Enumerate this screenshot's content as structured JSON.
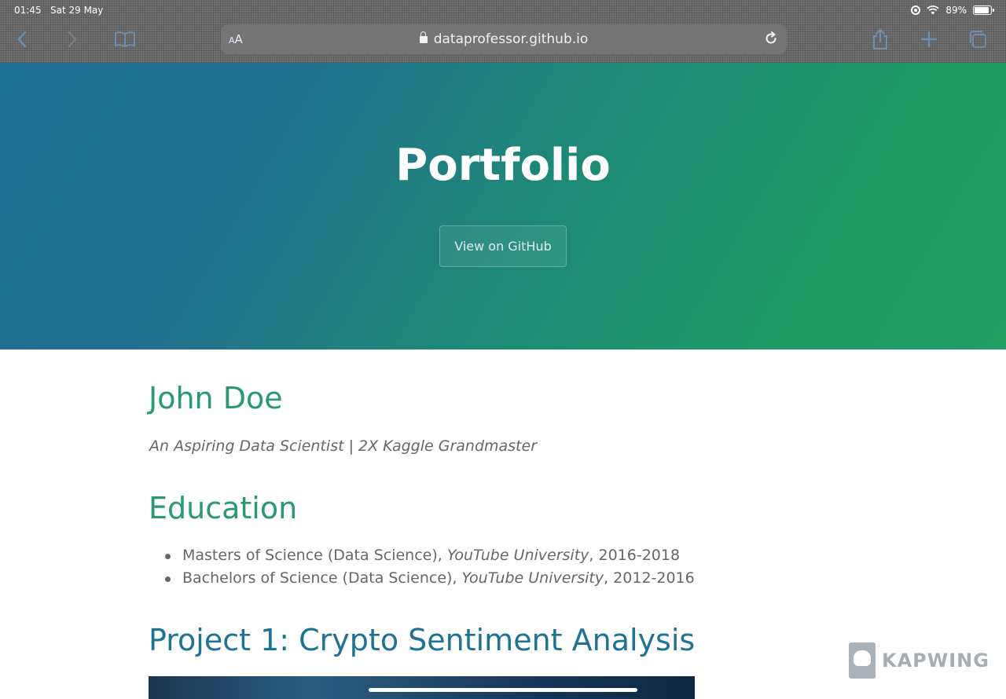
{
  "status_bar": {
    "time": "01:45",
    "date": "Sat 29 May",
    "battery": "89%",
    "battery_level": 0.89
  },
  "browser": {
    "aa_label_small": "A",
    "aa_label_large": "A",
    "url": "dataprofessor.github.io",
    "icons": [
      "back-icon",
      "forward-icon",
      "bookmarks-icon",
      "lock-icon",
      "reload-icon",
      "share-icon",
      "new-tab-icon",
      "tabs-icon"
    ]
  },
  "hero": {
    "title": "Portfolio",
    "button_label": "View on GitHub"
  },
  "profile": {
    "name": "John Doe",
    "tagline": "An Aspiring Data Scientist | 2X Kaggle Grandmaster"
  },
  "education": {
    "title": "Education",
    "items": [
      {
        "degree": "Masters of Science (Data Science), ",
        "school": "YouTube University",
        "years": ", 2016-2018"
      },
      {
        "degree": "Bachelors of Science (Data Science), ",
        "school": "YouTube University",
        "years": ", 2012-2016"
      }
    ]
  },
  "project": {
    "title": "Project 1: Crypto Sentiment Analysis"
  },
  "watermark": {
    "text": "KAPWING"
  },
  "colors": {
    "heading_green": "#2a9972",
    "heading_blue": "#1f7294",
    "hero_start": "#1f6f94",
    "hero_end": "#219d66"
  }
}
